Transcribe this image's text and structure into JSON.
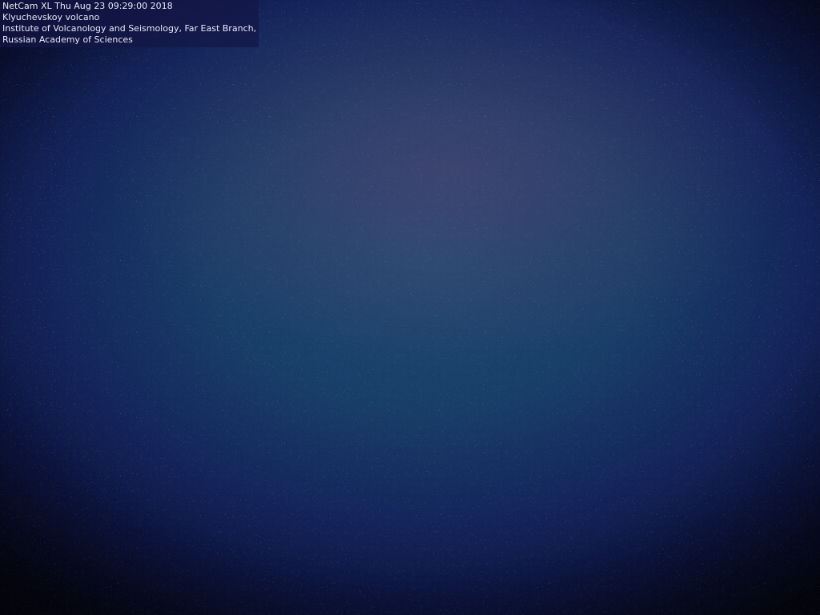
{
  "overlay": {
    "lines": [
      "NetCam XL Thu Aug 23 09:29:00 2018",
      "Klyuchevskoy volcano",
      "Institute of Volcanology and Seismology, Far East Branch,",
      "Russian Academy of Sciences"
    ]
  },
  "scene": {
    "description_colors": {
      "center": "#1d4a72",
      "edge": "#060818",
      "haze": "#96467a"
    }
  }
}
